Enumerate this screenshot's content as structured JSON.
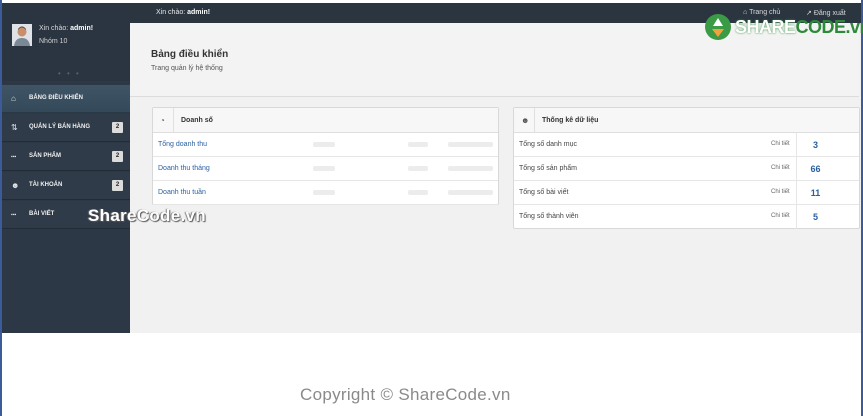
{
  "topbar": {
    "greet_prefix": "Xin chào: ",
    "greet_user": "admin!",
    "home_label": "Trang chủ",
    "logout_label": "Đăng xuất"
  },
  "user": {
    "hello_prefix": "Xin chào: ",
    "hello_user": "admin!",
    "group": "Nhóm 10",
    "dots": "• • •"
  },
  "menu": [
    {
      "icon": "home-icon",
      "glyph": "⌂",
      "label": "BẢNG ĐIỀU KHIỂN",
      "badge": ""
    },
    {
      "icon": "sort-icon",
      "glyph": "⇅",
      "label": "QUẢN LÝ BÁN HÀNG",
      "badge": "2"
    },
    {
      "icon": "grid-icon",
      "glyph": "▪▪▪",
      "label": "SẢN PHẨM",
      "badge": "2"
    },
    {
      "icon": "users-icon",
      "glyph": "☻",
      "label": "TÀI KHOẢN",
      "badge": "2"
    },
    {
      "icon": "grid-icon",
      "glyph": "▪▪▪",
      "label": "BÀI VIẾT",
      "badge": ""
    }
  ],
  "header": {
    "title": "Bảng điều khiển",
    "subtitle": "Trang quản lý hệ thống"
  },
  "sales_panel": {
    "title": "Doanh số",
    "rows": [
      {
        "label": "Tổng doanh thu"
      },
      {
        "label": "Doanh thu tháng"
      },
      {
        "label": "Doanh thu tuần"
      }
    ]
  },
  "stats_panel": {
    "title": "Thống kê dữ liệu",
    "rows": [
      {
        "label": "Tổng số danh mục",
        "detail": "Chi tiết",
        "value": "3"
      },
      {
        "label": "Tổng số sản phẩm",
        "detail": "Chi tiết",
        "value": "66"
      },
      {
        "label": "Tổng số bài viết",
        "detail": "Chi tiết",
        "value": "11"
      },
      {
        "label": "Tổng số thành viên",
        "detail": "Chi tiết",
        "value": "5"
      }
    ]
  },
  "watermarks": {
    "middle": "ShareCode.vn",
    "bottom": "Copyright © ShareCode.vn",
    "logo_share": "SHARE",
    "logo_code": "CODE.vn"
  }
}
